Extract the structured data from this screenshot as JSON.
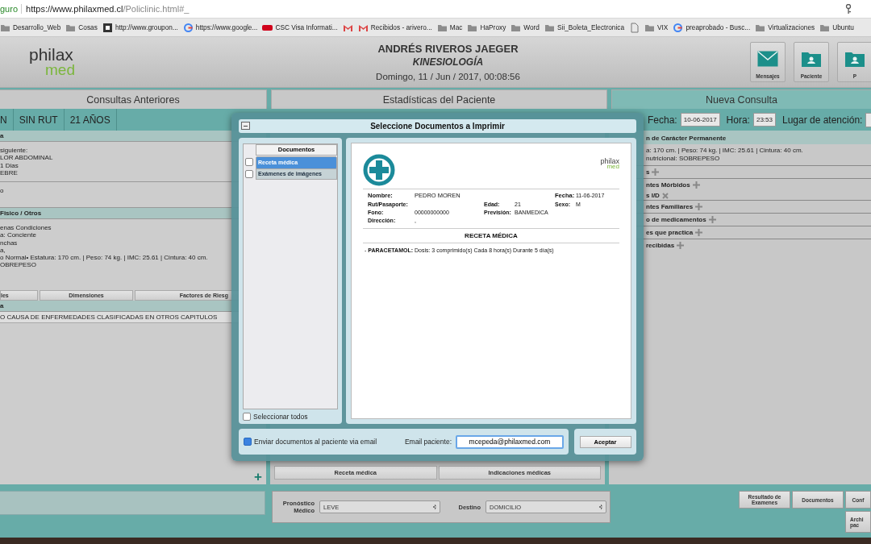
{
  "browser": {
    "security": "guro",
    "url_host": "https://www.philaxmed.cl",
    "url_path": "/Policlinic.html#_",
    "bookmarks": [
      {
        "kind": "folder",
        "label": "Desarrollo_Web"
      },
      {
        "kind": "folder",
        "label": "Cosas"
      },
      {
        "kind": "site",
        "label": "http://www.groupon..."
      },
      {
        "kind": "google",
        "label": "https://www.google..."
      },
      {
        "kind": "csc",
        "label": "CSC Visa Informati..."
      },
      {
        "kind": "gmail"
      },
      {
        "kind": "gmail",
        "label": "Recibidos - arivero..."
      },
      {
        "kind": "folder",
        "label": "Mac"
      },
      {
        "kind": "folder",
        "label": "HaProxy"
      },
      {
        "kind": "folder",
        "label": "Word"
      },
      {
        "kind": "folder",
        "label": "Sii_Boleta_Electronica"
      },
      {
        "kind": "file"
      },
      {
        "kind": "folder",
        "label": "VIX"
      },
      {
        "kind": "google",
        "label": "preaprobado - Busc..."
      },
      {
        "kind": "folder",
        "label": "Virtualizaciones"
      },
      {
        "kind": "folder",
        "label": "Ubuntu"
      }
    ]
  },
  "header": {
    "logo_top": "philax",
    "logo_bottom": "med",
    "doctor": "ANDRÉS RIVEROS JAEGER",
    "specialty": "KINESIOLOGÍA",
    "datetime": "Domingo, 11 / Jun / 2017, 00:08:56",
    "actions": [
      {
        "kind": "mail",
        "label": "Mensajes"
      },
      {
        "kind": "patient",
        "label": "Paciente"
      },
      {
        "kind": "patient",
        "label": "P"
      }
    ]
  },
  "tabs": [
    {
      "label": "Consultas Anteriores",
      "selected": false
    },
    {
      "label": "Estadísticas del Paciente",
      "selected": false
    },
    {
      "label": "Nueva Consulta",
      "selected": true
    }
  ],
  "patient_bar": [
    "N",
    "SIN RUT",
    "21 AÑOS"
  ],
  "left_panel": {
    "sections": [
      {
        "heading": "a",
        "lines": [
          "siguiente:",
          "LOR ABDOMINAL",
          "1 Dias",
          "EBRE"
        ]
      },
      {
        "lines": [
          "o"
        ]
      },
      {
        "heading": "Fisico / Otros",
        "lines": [
          "enas Condiciones",
          "a: Conciente",
          "nchas",
          "a,",
          "o Normal• Estatura: 170 cm. | Peso: 74 kg. | IMC: 25.61 | Cintura: 40 cm.",
          "OBREPESO"
        ]
      }
    ],
    "subtabs": [
      "les",
      "Dimensiones",
      "Factores de Riesg"
    ],
    "diagnosis": {
      "heading": "a",
      "lines": [
        "O CAUSA DE ENFERMEDADES CLASIFICADAS EN OTROS CAPITULOS"
      ]
    },
    "add_button": "+"
  },
  "middle_panel": {
    "bottom_tabs": [
      "Receta médica",
      "Indicaciones médicas"
    ]
  },
  "consult_bar": {
    "date_label": "Fecha:",
    "date": "10-06-2017",
    "time_label": "Hora:",
    "time": "23:53",
    "place_label": "Lugar de atención:"
  },
  "right_panel": {
    "rows": [
      {
        "kind": "heading",
        "text": "n de Carácter Permanente"
      },
      {
        "kind": "text",
        "text": "a: 170 cm. | Peso: 74 kg. | IMC: 25.61 | Cintura: 40 cm."
      },
      {
        "kind": "text",
        "text": "nutricional: SOBREPESO"
      },
      {
        "kind": "add",
        "text": "s"
      },
      {
        "kind": "add",
        "text": "ntes Mórbidos"
      },
      {
        "kind": "remove",
        "text": "s I/D"
      },
      {
        "kind": "add",
        "text": "ntes Familiares"
      },
      {
        "kind": "add",
        "text": "o de medicamentos"
      },
      {
        "kind": "add",
        "text": "es que practica"
      },
      {
        "kind": "add",
        "text": "recibidas"
      }
    ]
  },
  "footer": {
    "prognosis_label": "Pronóstico Médico",
    "prognosis": "LEVE",
    "destination_label": "Destino",
    "destination": "DOMICILIO",
    "buttons": [
      "Resultado de Examenes",
      "Documentos",
      "Conf",
      "Archi pac"
    ]
  },
  "dialog": {
    "title": "Seleccione Documentos a Imprimir",
    "list_header": "Documentos",
    "documents": [
      {
        "label": "Receta médica",
        "checked": false,
        "selected": true
      },
      {
        "label": "Exámenes de imágenes",
        "checked": false,
        "selected": false
      }
    ],
    "select_all": {
      "label": "Seleccionar todos",
      "checked": false
    },
    "preview": {
      "logo_top": "philax",
      "logo_bottom": "med",
      "rows": [
        {
          "left": {
            "label": "Nombre:",
            "value": "PEDRO MOREN"
          },
          "right": {
            "label": "Fecha:",
            "value": "11-06-2017"
          }
        },
        {
          "left": {
            "label": "Rut/Pasaporte:"
          },
          "middle": {
            "label": "Edad:",
            "value": "21"
          },
          "right": {
            "label": "Sexo:",
            "value": "M"
          }
        },
        {
          "left": {
            "label": "Fono:",
            "value": "00000000000"
          },
          "middle": {
            "label": "Previsión:",
            "value": "BANMEDICA"
          }
        },
        {
          "left": {
            "label": "Dirección:",
            "value": ","
          }
        }
      ],
      "doc_title": "RECETA MÉDICA",
      "items": [
        "- **PARACETAMOL:** Dosis: 3 comprimido(s) Cada 8 hora(s) Durante 5 día(s)"
      ]
    },
    "send_email": {
      "label": "Enviar documentos al paciente via email",
      "checked": true
    },
    "email_label": "Email paciente:",
    "email": "mcepeda@philaxmed.com",
    "accept": "Aceptar"
  }
}
